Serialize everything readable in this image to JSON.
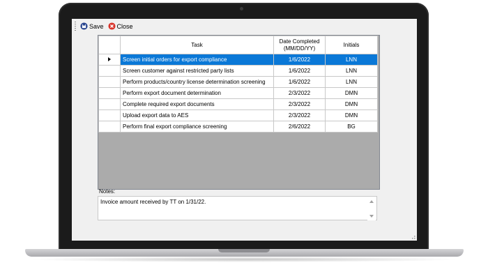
{
  "toolbar": {
    "save_label": "Save",
    "close_label": "Close"
  },
  "table": {
    "columns": [
      "Task",
      "Date Completed\n(MM/DD/YY)",
      "Initials"
    ],
    "rows": [
      {
        "task": "Screen initial orders for export compliance",
        "date": "1/6/2022",
        "initials": "LNN",
        "selected": true
      },
      {
        "task": "Screen customer against restricted party lists",
        "date": "1/6/2022",
        "initials": "LNN"
      },
      {
        "task": "Perform products/country license determination screening",
        "date": "1/6/2022",
        "initials": "LNN"
      },
      {
        "task": "Perform export document determination",
        "date": "2/3/2022",
        "initials": "DMN"
      },
      {
        "task": "Complete required export documents",
        "date": "2/3/2022",
        "initials": "DMN"
      },
      {
        "task": "Upload export data to AES",
        "date": "2/3/2022",
        "initials": "DMN"
      },
      {
        "task": "Perform final export compliance screening",
        "date": "2/6/2022",
        "initials": "BG"
      }
    ]
  },
  "notes": {
    "label": "Notes:",
    "value": "Invoice amount received by TT on 1/31/22."
  },
  "colors": {
    "selection": "#0a78d7",
    "save_icon": "#1f3d8a",
    "close_icon": "#d9342b",
    "bezel": "#1b1b1b"
  },
  "icons": {
    "save": "save-icon",
    "close": "close-circle-icon",
    "row_pointer": "row-pointer-icon"
  }
}
